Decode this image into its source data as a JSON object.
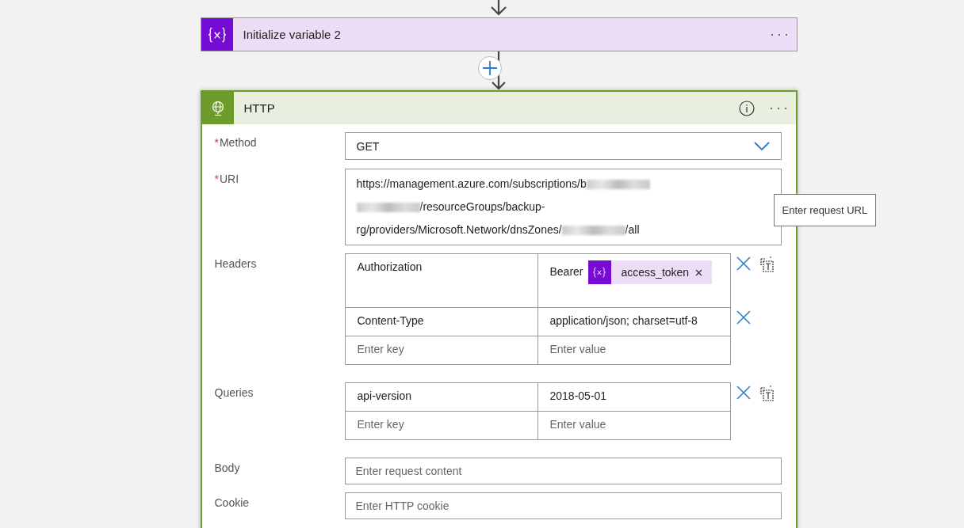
{
  "previous_step": {
    "title": "Initialize variable 2",
    "kind": "variable"
  },
  "step": {
    "title": "HTTP",
    "kind": "http",
    "fields": [
      {
        "kind": "select",
        "required_mark": "*",
        "label": "Method",
        "value": "GET"
      },
      {
        "kind": "multiline",
        "required_mark": "*",
        "label": "URI",
        "lines": [
          [
            {
              "kind": "text",
              "text": "https://management.azure.com/subscriptions/b"
            },
            {
              "kind": "redacted"
            }
          ],
          [
            {
              "kind": "redacted"
            },
            {
              "kind": "text",
              "text": "/resourceGroups/backup-"
            }
          ],
          [
            {
              "kind": "text",
              "text": "rg/providers/Microsoft.Network/dnsZones/"
            },
            {
              "kind": "redacted"
            },
            {
              "kind": "text",
              "text": "/all"
            }
          ]
        ],
        "tooltip": "Enter request URL"
      },
      {
        "kind": "table",
        "label": "Headers",
        "rows": [
          {
            "key": "Authorization",
            "value": [
              {
                "kind": "text",
                "text": "Bearer"
              },
              {
                "kind": "token",
                "text": "access_token"
              }
            ],
            "removable": true,
            "text_mode_toggle": true
          },
          {
            "key": "Content-Type",
            "value": [
              {
                "kind": "text",
                "text": "application/json; charset=utf-8"
              }
            ],
            "removable": true,
            "text_mode_toggle": false
          },
          {
            "key_placeholder": "Enter key",
            "value_placeholder": "Enter value",
            "removable": false,
            "text_mode_toggle": false
          }
        ]
      },
      {
        "kind": "table",
        "label": "Queries",
        "rows": [
          {
            "key": "api-version",
            "value": [
              {
                "kind": "text",
                "text": "2018-05-01"
              }
            ],
            "removable": true,
            "text_mode_toggle": true
          },
          {
            "key_placeholder": "Enter key",
            "value_placeholder": "Enter value",
            "removable": false,
            "text_mode_toggle": false
          }
        ]
      },
      {
        "kind": "input",
        "label": "Body",
        "placeholder": "Enter request content"
      },
      {
        "kind": "input",
        "label": "Cookie",
        "placeholder": "Enter HTTP cookie"
      }
    ]
  }
}
